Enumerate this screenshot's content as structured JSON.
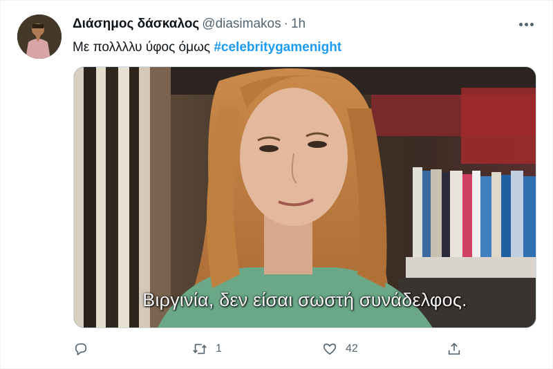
{
  "tweet": {
    "author_name": "Διάσημος δάσκαλος",
    "author_handle": "@diasimakos",
    "separator": "·",
    "time": "1h",
    "text": "Με πολλλλυ ύφος όμως ",
    "hashtag": "#celebritygamenight"
  },
  "media": {
    "subtitle": "Βιργινία, δεν είσαι σωστή συνάδελφος."
  },
  "actions": {
    "reply_icon": "reply-icon",
    "retweet_icon": "retweet-icon",
    "retweet_count": "1",
    "like_icon": "heart-icon",
    "like_count": "42",
    "share_icon": "share-icon"
  },
  "colors": {
    "link": "#1d9bf0",
    "secondary_text": "#536471",
    "primary_text": "#0f1419"
  }
}
